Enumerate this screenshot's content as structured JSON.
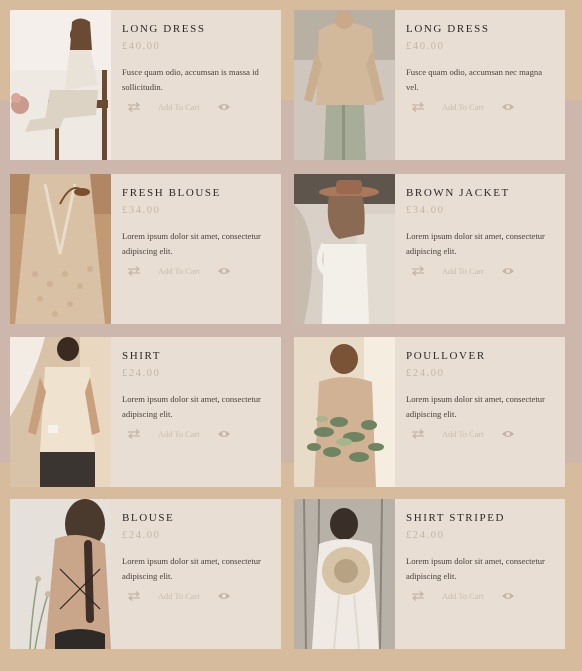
{
  "products": [
    {
      "title": "LONG DRESS",
      "price": "£40.00",
      "description": "Fusce quam odio, accumsan is massa id sollicitudin.",
      "cart_label": "Add To Cart",
      "photo": "woman-seated-camera"
    },
    {
      "title": "LONG DRESS",
      "price": "£40.00",
      "description": "Fusce quam odio, accumsan nec magna vel.",
      "cart_label": "Add To Cart",
      "photo": "woman-beige-sweater"
    },
    {
      "title": "FRESH BLOUSE",
      "price": "£34.00",
      "description": "Lorem ipsum dolor sit amet, consectetur adipiscing elit.",
      "cart_label": "Add To Cart",
      "photo": "lace-back-blouse"
    },
    {
      "title": "BROWN JACKET",
      "price": "£34.00",
      "description": "Lorem ipsum dolor sit amet, consectetur adipiscing elit.",
      "cart_label": "Add To Cart",
      "photo": "woman-wide-hat"
    },
    {
      "title": "SHIRT",
      "price": "£24.00",
      "description": "Lorem ipsum dolor sit amet, consectetur adipiscing elit.",
      "cart_label": "Add To Cart",
      "photo": "woman-cream-top-cup"
    },
    {
      "title": "POULLOVER",
      "price": "£24.00",
      "description": "Lorem ipsum dolor sit amet, consectetur adipiscing elit.",
      "cart_label": "Add To Cart",
      "photo": "woman-bouquet-back"
    },
    {
      "title": "BLOUSE",
      "price": "£24.00",
      "description": "Lorem ipsum dolor sit amet, consectetur adipiscing elit.",
      "cart_label": "Add To Cart",
      "photo": "woman-braid-back"
    },
    {
      "title": "SHIRT STRIPED",
      "price": "£24.00",
      "description": "Lorem ipsum dolor sit amet, consectetur adipiscing elit.",
      "cart_label": "Add To Cart",
      "photo": "woman-hat-behind"
    }
  ],
  "icons": {
    "compare": "swap-arrows-icon",
    "quick_view": "eye-icon"
  },
  "colors": {
    "page_bg": "#d6bc9c",
    "band_bg": "#cdb6ac",
    "card_bg": "#e8ded3",
    "title": "#2d2926",
    "muted": "#c4b5a6"
  }
}
